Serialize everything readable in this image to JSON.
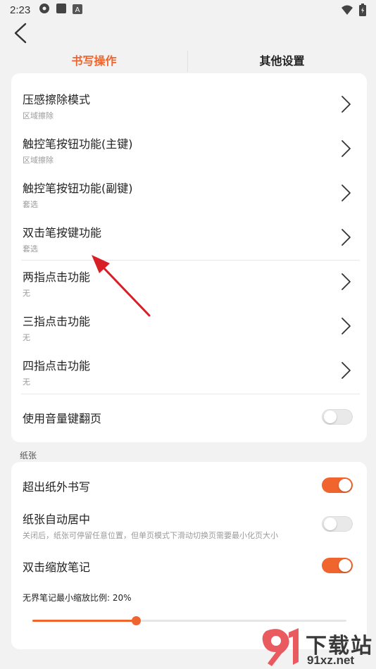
{
  "status": {
    "time": "2:23"
  },
  "tabs": [
    {
      "label": "书写操作",
      "active": true
    },
    {
      "label": "其他设置",
      "active": false
    }
  ],
  "card1": {
    "items": [
      {
        "title": "压感擦除模式",
        "value": "区域擦除"
      },
      {
        "title": "触控笔按钮功能(主键)",
        "value": "区域擦除"
      },
      {
        "title": "触控笔按钮功能(副键)",
        "value": "套选"
      },
      {
        "title": "双击笔按键功能",
        "value": "套选"
      },
      {
        "title": "两指点击功能",
        "value": "无"
      },
      {
        "title": "三指点击功能",
        "value": "无"
      },
      {
        "title": "四指点击功能",
        "value": "无"
      }
    ],
    "volume_toggle": {
      "label": "使用音量键翻页",
      "on": false
    }
  },
  "paper": {
    "section_label": "纸张",
    "write_outside": {
      "label": "超出纸外书写",
      "on": true
    },
    "auto_center": {
      "label": "纸张自动居中",
      "desc": "关闭后，纸张可停留任意位置，但单页模式下滑动切换页需要最小化页大小",
      "on": false
    },
    "double_tap_zoom": {
      "label": "双击缩放笔记",
      "on": true
    },
    "min_zoom": {
      "label": "无界笔记最小缩放比例: 20%",
      "value": 0.33
    }
  },
  "watermark": {
    "brand": "下载站",
    "url": "91xz.net"
  },
  "colors": {
    "accent": "#f0642d",
    "annotation": "#d81f26"
  }
}
